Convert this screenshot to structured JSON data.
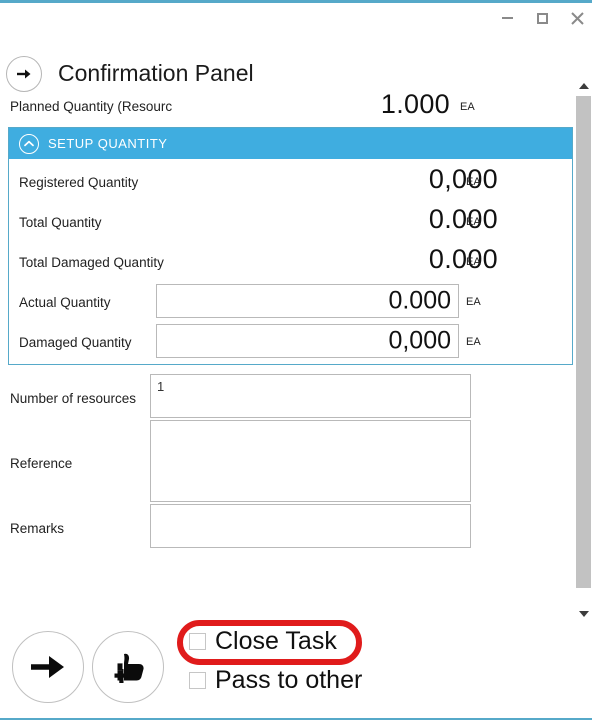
{
  "window": {
    "title": "Confirmation Panel",
    "accent_color": "#3fade0",
    "border_color": "#56a9c9",
    "controls": {
      "minimize_label": "Minimize",
      "maximize_label": "Maximize",
      "close_label": "Close"
    }
  },
  "header": {
    "back_icon": "arrow-right-circle-icon",
    "title": "Confirmation Panel"
  },
  "top_row": {
    "label": "Planned Quantity (Resourc",
    "value": "1.000",
    "unit": "EA"
  },
  "setup_panel": {
    "header_label": "SETUP QUANTITY",
    "collapse_icon": "chevron-up-circle-icon",
    "rows": [
      {
        "label": "Registered Quantity",
        "value": "0,000",
        "unit": "EA",
        "editable": false
      },
      {
        "label": "Total Quantity",
        "value": "0.000",
        "unit": "EA",
        "editable": false
      },
      {
        "label": "Total Damaged Quantity",
        "value": "0.000",
        "unit": "EA",
        "editable": false
      },
      {
        "label": "Actual Quantity",
        "value": "0.000",
        "unit": "EA",
        "editable": true
      },
      {
        "label": "Damaged Quantity",
        "value": "0,000",
        "unit": "EA",
        "editable": true
      }
    ]
  },
  "form": {
    "fields": [
      {
        "label": "Number of resources",
        "value": "1",
        "placeholder": ""
      },
      {
        "label": "Reference",
        "value": "",
        "placeholder": ""
      },
      {
        "label": "Remarks",
        "value": "",
        "placeholder": ""
      }
    ]
  },
  "actions": {
    "forward_button": {
      "icon": "arrow-right-icon",
      "label": "Forward"
    },
    "approve_button": {
      "icon": "thumbs-up-plus-icon",
      "label": "Approve"
    },
    "checkboxes": [
      {
        "label": "Close Task",
        "checked": false
      },
      {
        "label": "Pass to other",
        "checked": false
      }
    ]
  },
  "scrollbar": {
    "up_icon": "triangle-up-icon",
    "down_icon": "triangle-down-icon",
    "thumb_label": "Scroll thumb"
  },
  "annotation": {
    "shape": "rounded-rectangle",
    "color": "#e01b1b",
    "target": "Close Task"
  }
}
